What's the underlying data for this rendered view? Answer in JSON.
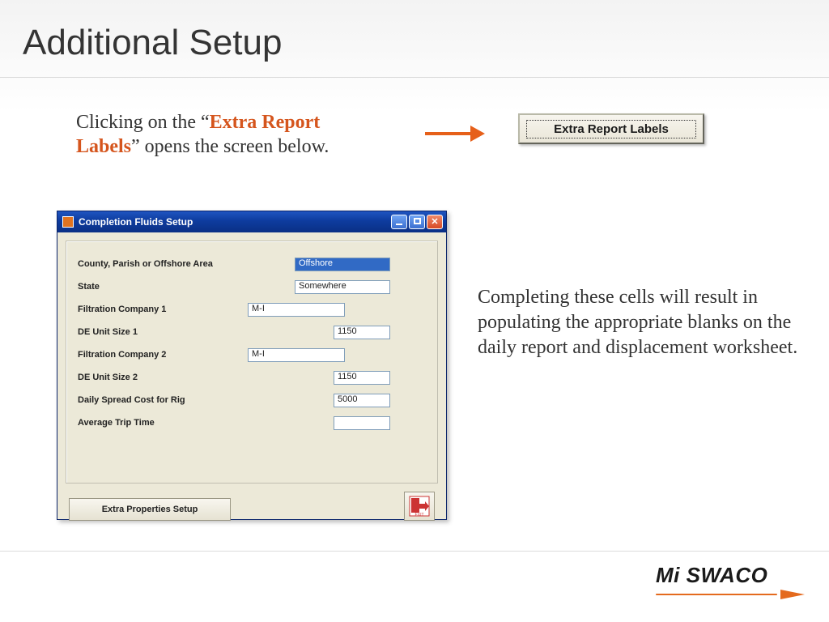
{
  "title": "Additional Setup",
  "intro": {
    "pre": "Clicking on the “",
    "hl": "Extra Report Labels",
    "post": "” opens the screen below."
  },
  "extra_report_labels_button": "Extra Report Labels",
  "description": "Completing these cells will result in populating the appropriate blanks on the daily report  and displacement worksheet.",
  "dialog": {
    "title": "Completion Fluids Setup",
    "extra_properties_button": "Extra Properties Setup",
    "exit_label": "EXIT",
    "fields": {
      "county_label": "County, Parish or Offshore Area",
      "county_value": "Offshore",
      "state_label": "State",
      "state_value": "Somewhere",
      "fc1_label": "Filtration Company 1",
      "fc1_value": "M-I",
      "de1_label": "DE Unit Size 1",
      "de1_value": "1150",
      "fc2_label": "Filtration Company 2",
      "fc2_value": "M-I",
      "de2_label": "DE Unit Size 2",
      "de2_value": "1150",
      "spread_label": "Daily Spread Cost for Rig",
      "spread_value": "5000",
      "trip_label": "Average Trip Time",
      "trip_value": ""
    }
  },
  "logo": {
    "mi": "Mi",
    "swaco": " SWACO"
  }
}
